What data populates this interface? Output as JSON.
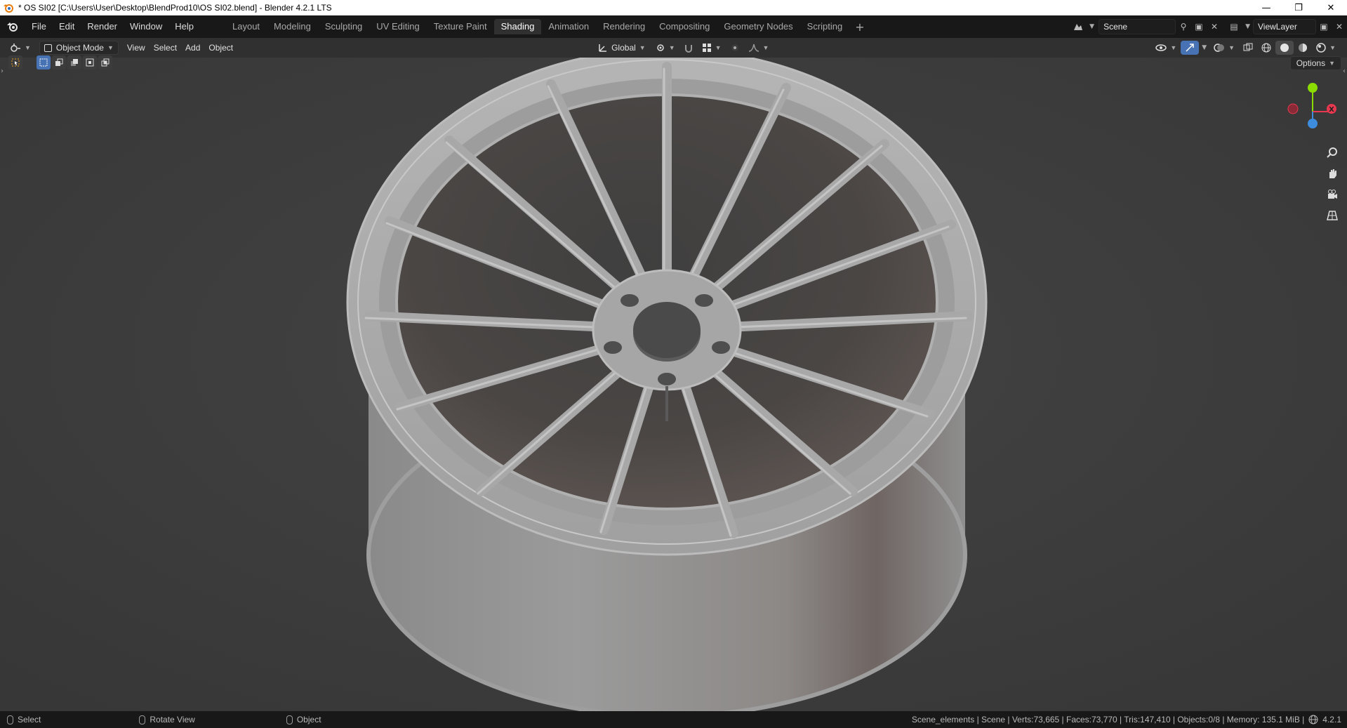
{
  "window": {
    "title": "* OS SI02 [C:\\Users\\User\\Desktop\\BlendProd10\\OS SI02.blend] - Blender 4.2.1 LTS",
    "controls": [
      "—",
      "❐",
      "✕"
    ]
  },
  "menus": [
    "File",
    "Edit",
    "Render",
    "Window",
    "Help"
  ],
  "workspaces": [
    {
      "label": "Layout",
      "active": false
    },
    {
      "label": "Modeling",
      "active": false
    },
    {
      "label": "Sculpting",
      "active": false
    },
    {
      "label": "UV Editing",
      "active": false
    },
    {
      "label": "Texture Paint",
      "active": false
    },
    {
      "label": "Shading",
      "active": true
    },
    {
      "label": "Animation",
      "active": false
    },
    {
      "label": "Rendering",
      "active": false
    },
    {
      "label": "Compositing",
      "active": false
    },
    {
      "label": "Geometry Nodes",
      "active": false
    },
    {
      "label": "Scripting",
      "active": false
    }
  ],
  "add_workspace": "+",
  "scene": {
    "name": "Scene",
    "view_layer": "ViewLayer"
  },
  "viewport_header": {
    "mode": "Object Mode",
    "menus": [
      "View",
      "Select",
      "Add",
      "Object"
    ],
    "transform_orientation": "Global",
    "options_label": "Options"
  },
  "status": {
    "left": [
      {
        "label": "Select"
      },
      {
        "label": "Rotate View"
      },
      {
        "label": "Object"
      }
    ],
    "right": "Scene_elements | Scene | Verts:73,665 | Faces:73,770 | Tris:147,410 | Objects:0/8 | Memory: 135.1 MiB | ",
    "version": "4.2.1"
  },
  "gizmo": {
    "x_label": "X",
    "x_color": "#e8384f",
    "y_color": "#8bdc00",
    "z_color": "#3d8cde"
  },
  "colors": {
    "accent": "#4772b3",
    "viewport_bg": "#3d3d3d",
    "topbar": "#181818"
  }
}
